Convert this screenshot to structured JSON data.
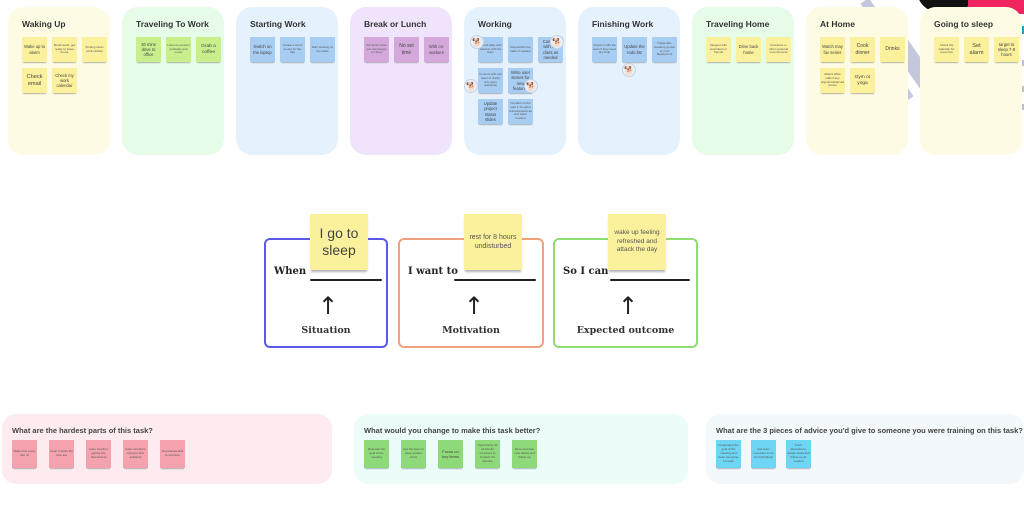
{
  "stages": [
    {
      "title": "Waking Up",
      "stickies": [
        "Wake up to alarm",
        "Brush teeth, get ready to leave house",
        "Finding clean work clothes",
        "Check email",
        "Check my work calendar"
      ]
    },
    {
      "title": "Traveling To Work",
      "stickies": [
        "30 mins drive to office",
        "Listen to product podcasts and music",
        "Grab a coffee"
      ]
    },
    {
      "title": "Starting Work",
      "stickies": [
        "Switch on the laptop",
        "Create a list of to-dos for the day",
        "Start working on the tasks"
      ]
    },
    {
      "title": "Break or Lunch",
      "stickies": [
        "Get lunch when you are hungry (or free)",
        "No set time",
        "With co-workers"
      ]
    },
    {
      "title": "Working",
      "stickies": [
        "Attend daily with standup with the team",
        "Reprioritize the tasks if needed",
        "Connect with the client as needed",
        "Connect with dev team to clarify any open questions",
        "Write user stories for new features",
        "Update project status slides",
        "Conduct on the spot 1:1s sprint retros/reviews as and when needed"
      ]
    },
    {
      "title": "Finishing Work",
      "stickies": [
        "Check in with the team if they need any help",
        "Update the todo list",
        "Triage late-breaking go-live or prod deployment"
      ]
    },
    {
      "title": "Traveling Home",
      "stickies": [
        "hangout with coworkers or friends",
        "Drive back home",
        "Groceries or other personal commitments"
      ]
    },
    {
      "title": "At Home",
      "stickies": [
        "Watch may fav series",
        "Cook dinner",
        "Drinks",
        "Attend office calls if any urgent/unplanned issues",
        "Gym or yoga"
      ]
    },
    {
      "title": "Going to sleep",
      "stickies": [
        "Check the calendar for tomorrow",
        "Set alarm",
        "target to sleep 7-8 hours"
      ]
    }
  ],
  "jtbd": {
    "when": {
      "lead": "When",
      "sticky": "I go to sleep",
      "caption": "Situation",
      "arrow": "↑"
    },
    "want": {
      "lead": "I want to",
      "sticky": "rest for 8 hours undisturbed",
      "caption": "Motivation",
      "arrow": "↑"
    },
    "so": {
      "lead": "So I can",
      "sticky": "wake up feeling refreshed and attack the day",
      "caption": "Expected outcome",
      "arrow": "↑"
    }
  },
  "questions": [
    {
      "title": "What are the hardest parts of this task?",
      "stickies": [
        "Make time every day :D",
        "Keep it within the time set",
        "team member getting into discussions",
        "team members trying to find solutions",
        "Sometimes lack to structure"
      ]
    },
    {
      "title": "What would you change to make this task better?",
      "stickies": [
        "Reiterate the goal of the meeting",
        "Ask the team to keep update short",
        "Focus on key items",
        "Opportunity for all-hands/ members to conduct the standup",
        "More accurate note taking and follow-up"
      ]
    },
    {
      "title": "What are the 3 pieces of advice you'd give to someone you were training on this task?",
      "stickies": [
        "Understand the goal of the meeting and keep everyone on track",
        "Ask team members to be short (Politely)",
        "Track discussions, assign tasks and follow-up as needed"
      ]
    }
  ],
  "icons": {
    "collaborator_avatar": "🐕"
  }
}
